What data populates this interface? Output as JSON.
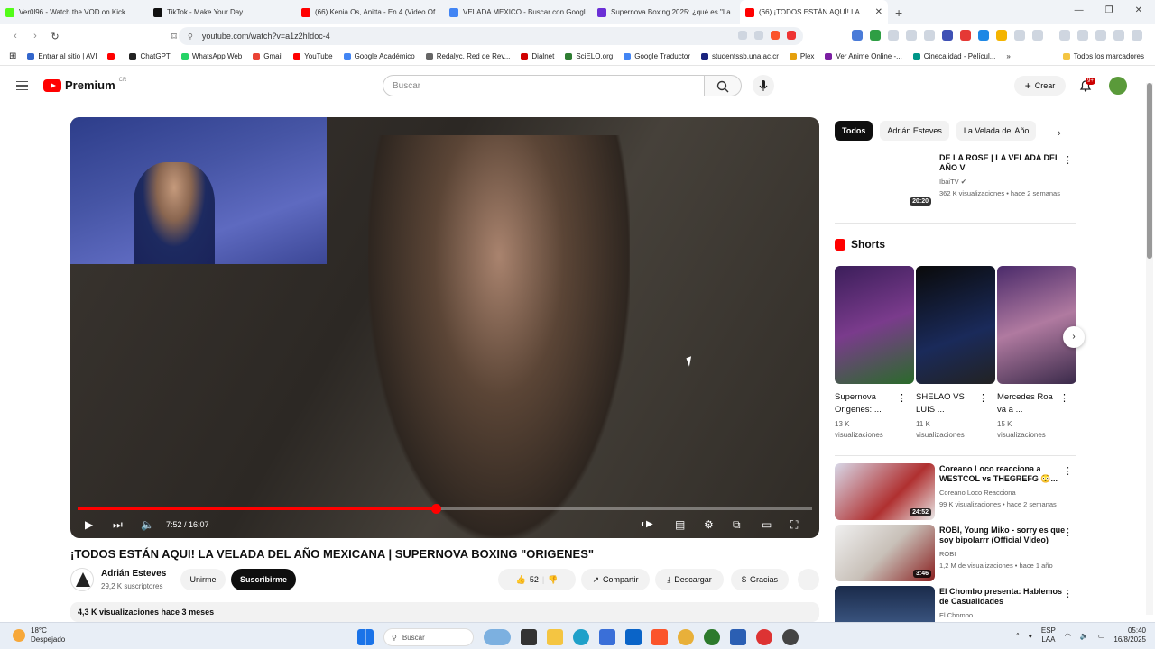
{
  "browser": {
    "tabs": [
      {
        "title": "Ver0l96 - Watch the VOD on Kick",
        "color": "#53fc18"
      },
      {
        "title": "TikTok - Make Your Day",
        "color": "#111111"
      },
      {
        "title": "(66) Kenia Os, Anitta - En 4 (Video Of",
        "color": "#ff0000"
      },
      {
        "title": "VELADA MEXICO - Buscar con Googl",
        "color": "#4285f4"
      },
      {
        "title": "Supernova Boxing 2025: ¿qué es \"La",
        "color": "#6b2fd6"
      },
      {
        "title": "(66) ¡TODOS ESTÁN AQUÍ! LA VE",
        "color": "#ff0000",
        "active": true
      }
    ],
    "url": "youtube.com/watch?v=a1z2hIdoc-4",
    "bookmarks": [
      {
        "label": "Entrar al sitio | AVI",
        "color": "#3366cc"
      },
      {
        "label": "",
        "color": "#ff0000"
      },
      {
        "label": "ChatGPT",
        "color": "#222222"
      },
      {
        "label": "WhatsApp Web",
        "color": "#25d366"
      },
      {
        "label": "Gmail",
        "color": "#ea4335"
      },
      {
        "label": "YouTube",
        "color": "#ff0000"
      },
      {
        "label": "Google Académico",
        "color": "#4285f4"
      },
      {
        "label": "Redalyc. Red de Rev...",
        "color": "#666666"
      },
      {
        "label": "Dialnet",
        "color": "#d00000"
      },
      {
        "label": "SciELO.org",
        "color": "#2e7d32"
      },
      {
        "label": "Google Traductor",
        "color": "#4285f4"
      },
      {
        "label": "studentssb.una.ac.cr",
        "color": "#1a237e"
      },
      {
        "label": "Plex",
        "color": "#e5a00d"
      },
      {
        "label": "Ver Anime Online -...",
        "color": "#7b1fa2"
      },
      {
        "label": "Cinecalidad - Películ...",
        "color": "#009688"
      }
    ],
    "all_bookmarks": "Todos los marcadores"
  },
  "youtube": {
    "logo": "Premium",
    "logo_suffix": "CR",
    "search_placeholder": "Buscar",
    "create_label": "Crear",
    "notifications": "9+",
    "player": {
      "time": "7:52 / 16:07",
      "progress": 0.488
    },
    "video_title": "¡TODOS ESTÁN AQUI! LA VELADA DEL AÑO MEXICANA | SUPERNOVA BOXING \"ORIGENES\"",
    "channel": {
      "name": "Adrián Esteves",
      "subs": "29,2 K suscriptores",
      "join_label": "Unirme",
      "subscribe_label": "Suscribirme"
    },
    "actions": {
      "likes": "52",
      "share": "Compartir",
      "download": "Descargar",
      "thanks": "Gracias"
    },
    "description": "4,3 K visualizaciones  hace 3 meses",
    "chips": [
      "Todos",
      "Adrián Esteves",
      "La Velada del Año"
    ],
    "related_top": {
      "title": "DE LA ROSE | LA VELADA DEL AÑO V",
      "channel": "IbaiTV",
      "meta": "362 K visualizaciones • hace 2 semanas",
      "duration": "20:20"
    },
    "shorts_heading": "Shorts",
    "shorts": [
      {
        "title": "Supernova Origenes: ...",
        "views": "13 K visualizaciones"
      },
      {
        "title": "SHELAO VS LUIS ...",
        "views": "11 K visualizaciones"
      },
      {
        "title": "Mercedes Roa va a ...",
        "views": "15 K visualizaciones"
      }
    ],
    "related": [
      {
        "title": "Coreano Loco reacciona a WESTCOL vs THEGREFG 😳...",
        "channel": "Coreano Loco Reacciona",
        "meta": "99 K visualizaciones • hace 2 semanas",
        "duration": "24:52"
      },
      {
        "title": "ROBI, Young Miko - sorry es que soy bipolarrr (Official Video)",
        "channel": "ROBI",
        "meta": "1,2 M de visualizaciones • hace 1 año",
        "duration": "3:46"
      },
      {
        "title": "El Chombo presenta: Hablemos de Casualidades",
        "channel": "El Chombo",
        "meta": "",
        "duration": ""
      }
    ]
  },
  "taskbar": {
    "temp": "18°C",
    "weather": "Despejado",
    "search": "Buscar",
    "lang1": "ESP",
    "lang2": "LAA",
    "time": "05:40",
    "date": "16/8/2025"
  }
}
